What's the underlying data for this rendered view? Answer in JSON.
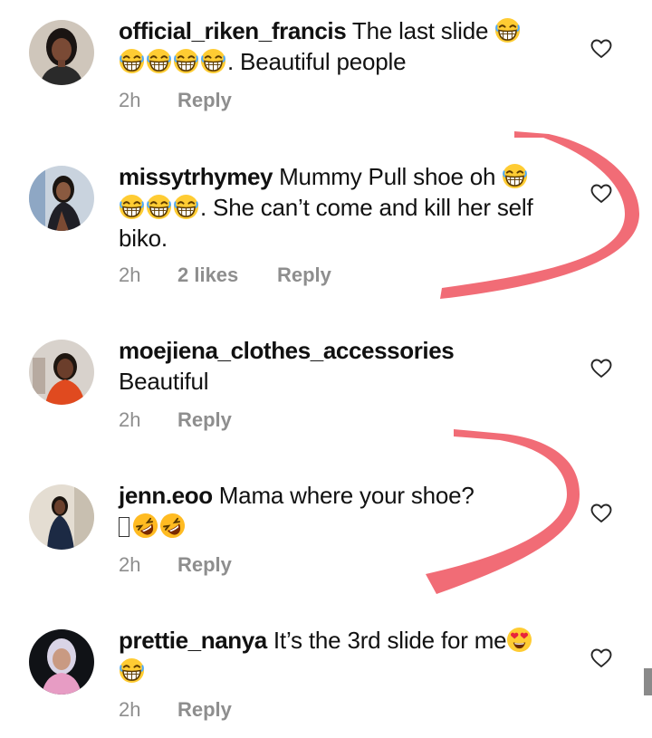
{
  "comments": [
    {
      "username": "official_riken_francis",
      "text_a": " The last slide ",
      "text_b": ". Beautiful people",
      "time": "2h",
      "reply": "Reply",
      "avatar_icon": "woman-portrait-avatar"
    },
    {
      "username": "missytrhymey",
      "text_a": " Mummy Pull shoe oh ",
      "text_b": ". She can’t come and kill her self biko.",
      "time": "2h",
      "likes": "2 likes",
      "reply": "Reply",
      "avatar_icon": "woman-portrait-avatar"
    },
    {
      "username": "moejiena_clothes_accessories",
      "text_a": "Beautiful",
      "time": "2h",
      "reply": "Reply",
      "avatar_icon": "woman-portrait-avatar"
    },
    {
      "username": "jenn.eoo",
      "text_a": " Mama where your shoe?",
      "time": "2h",
      "reply": "Reply",
      "avatar_icon": "woman-portrait-avatar"
    },
    {
      "username": "prettie_nanya",
      "text_a": " It’s the 3rd slide for me",
      "time": "2h",
      "reply": "Reply",
      "avatar_icon": "woman-portrait-avatar"
    }
  ],
  "icons": {
    "heart": "heart-outline-icon",
    "laughing": "grinning-squinting-face-emoji",
    "rofl": "rolling-on-floor-laughing-emoji",
    "heart_eyes": "heart-eyes-face-emoji"
  },
  "colors": {
    "username": "#111111",
    "meta": "#8e8e8e",
    "annotation_arrow": "#f0606a"
  }
}
